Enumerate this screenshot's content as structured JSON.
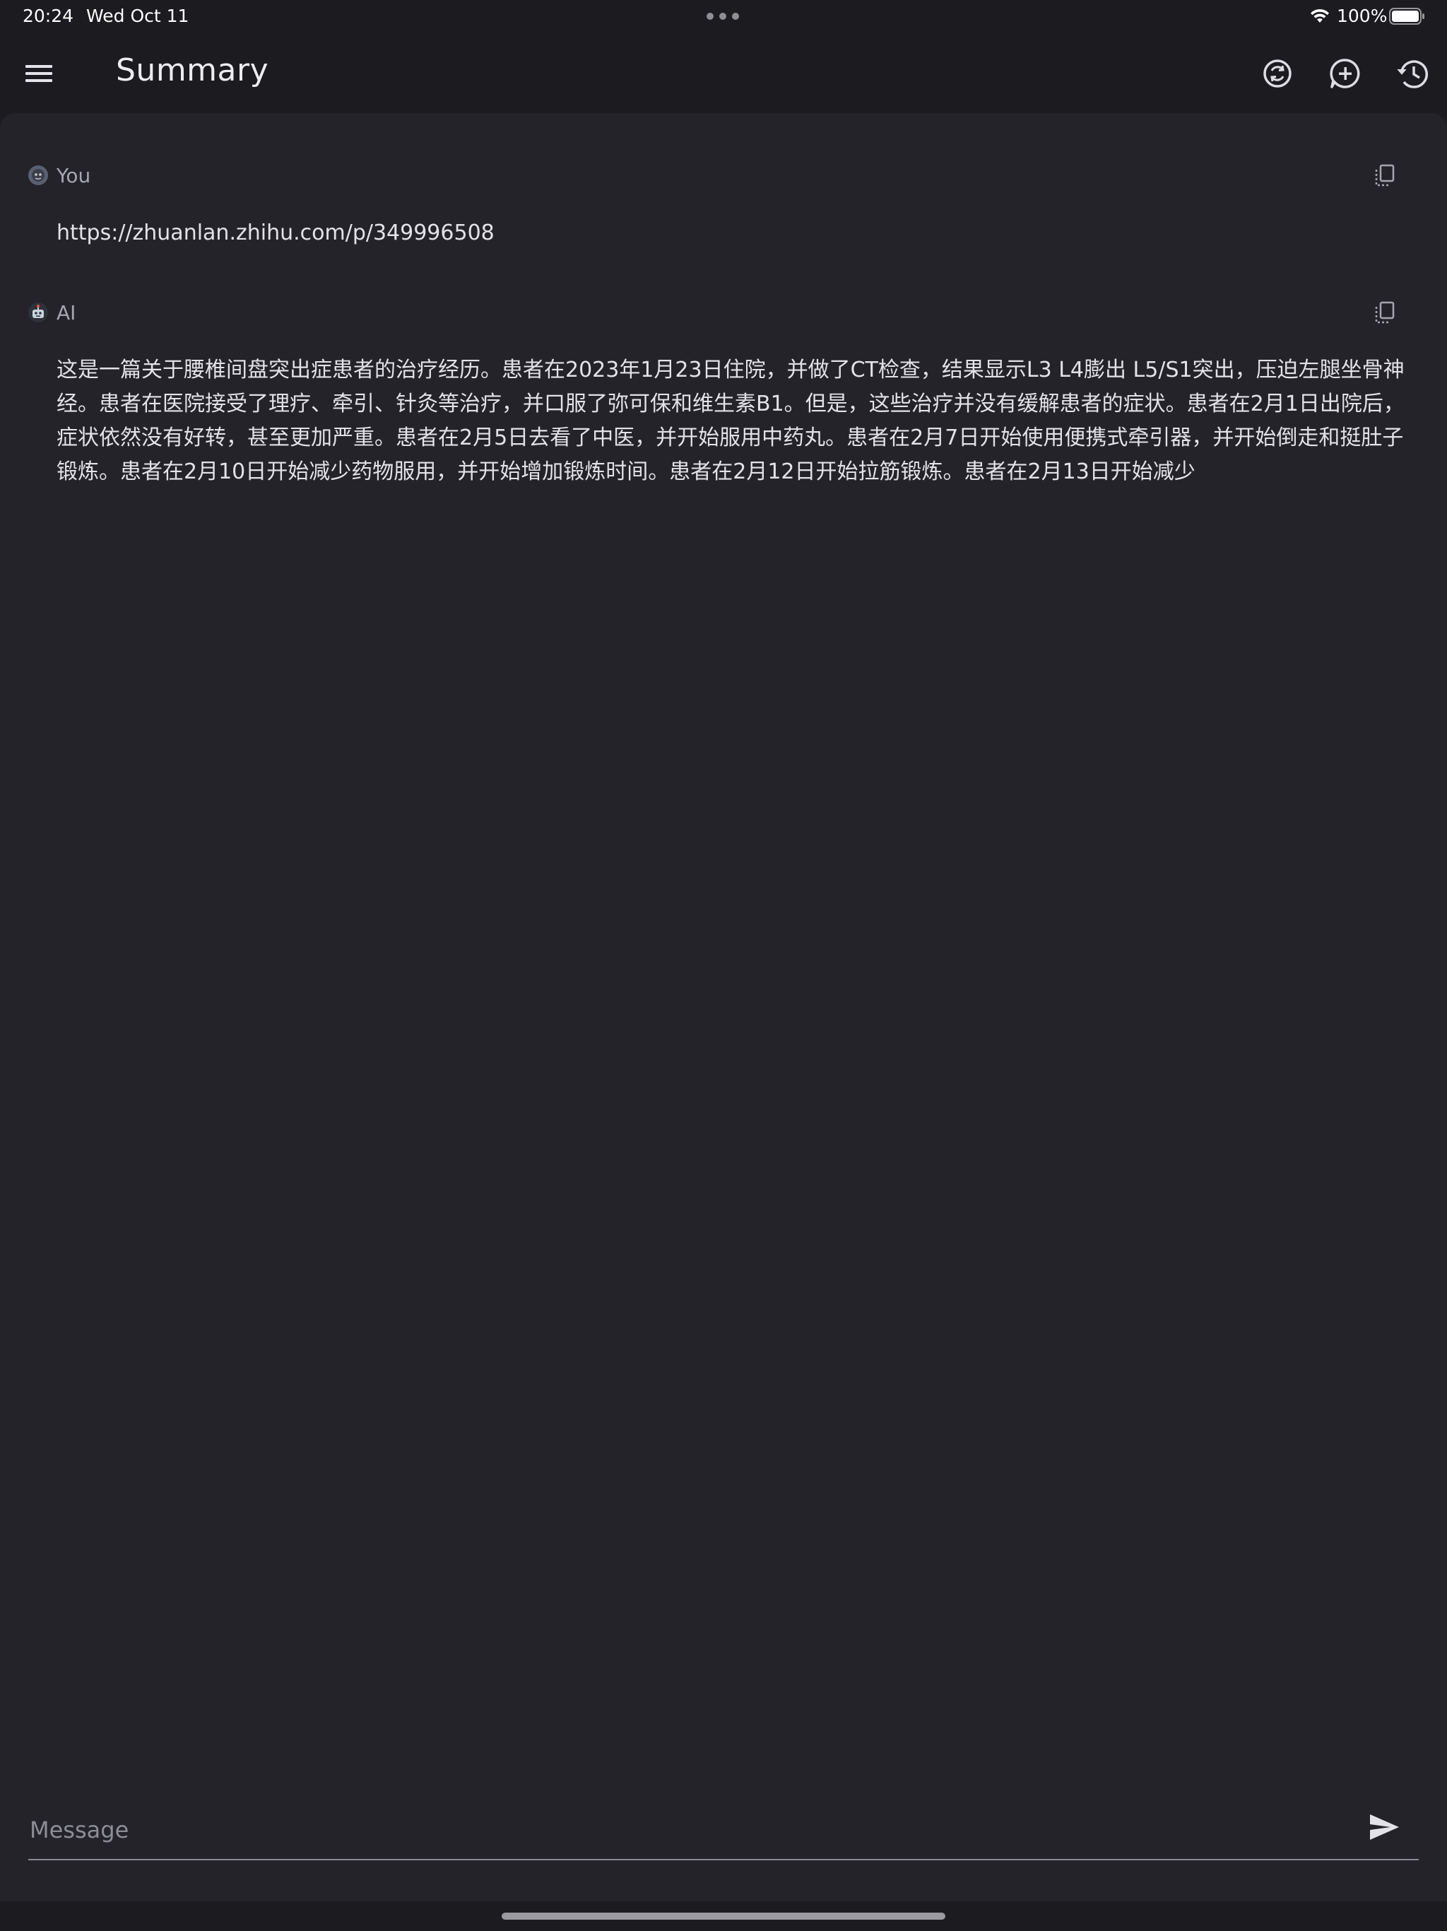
{
  "status_bar": {
    "time": "20:24",
    "date": "Wed Oct 11",
    "battery": "100%",
    "icons": [
      "wifi-icon",
      "battery-icon",
      "multitask-dots-icon"
    ]
  },
  "app_bar": {
    "title": "Summary",
    "icons": [
      "menu-icon",
      "refresh-icon",
      "new-chat-icon",
      "history-icon"
    ]
  },
  "messages": [
    {
      "role_label": "You",
      "text": "https://zhuanlan.zhihu.com/p/349996508",
      "icon": "user-avatar-icon"
    },
    {
      "role_label": "AI",
      "text": "这是一篇关于腰椎间盘突出症患者的治疗经历。患者在2023年1月23日住院，并做了CT检查，结果显示L3 L4膨出 L5/S1突出，压迫左腿坐骨神经。患者在医院接受了理疗、牵引、针灸等治疗，并口服了弥可保和维生素B1。但是，这些治疗并没有缓解患者的症状。患者在2月1日出院后，症状依然没有好转，甚至更加严重。患者在2月5日去看了中医，并开始服用中药丸。患者在2月7日开始使用便携式牵引器，并开始倒走和挺肚子锻炼。患者在2月10日开始减少药物服用，并开始增加锻炼时间。患者在2月12日开始拉筋锻炼。患者在2月13日开始减少",
      "icon": "robot-avatar-icon"
    }
  ],
  "composer": {
    "placeholder": "Message",
    "value": "",
    "send_icon": "send-icon"
  },
  "colors": {
    "background": "#1b1b20",
    "panel": "#232329",
    "text_primary": "#e2e2e8",
    "text_secondary": "#a6a6ae"
  }
}
